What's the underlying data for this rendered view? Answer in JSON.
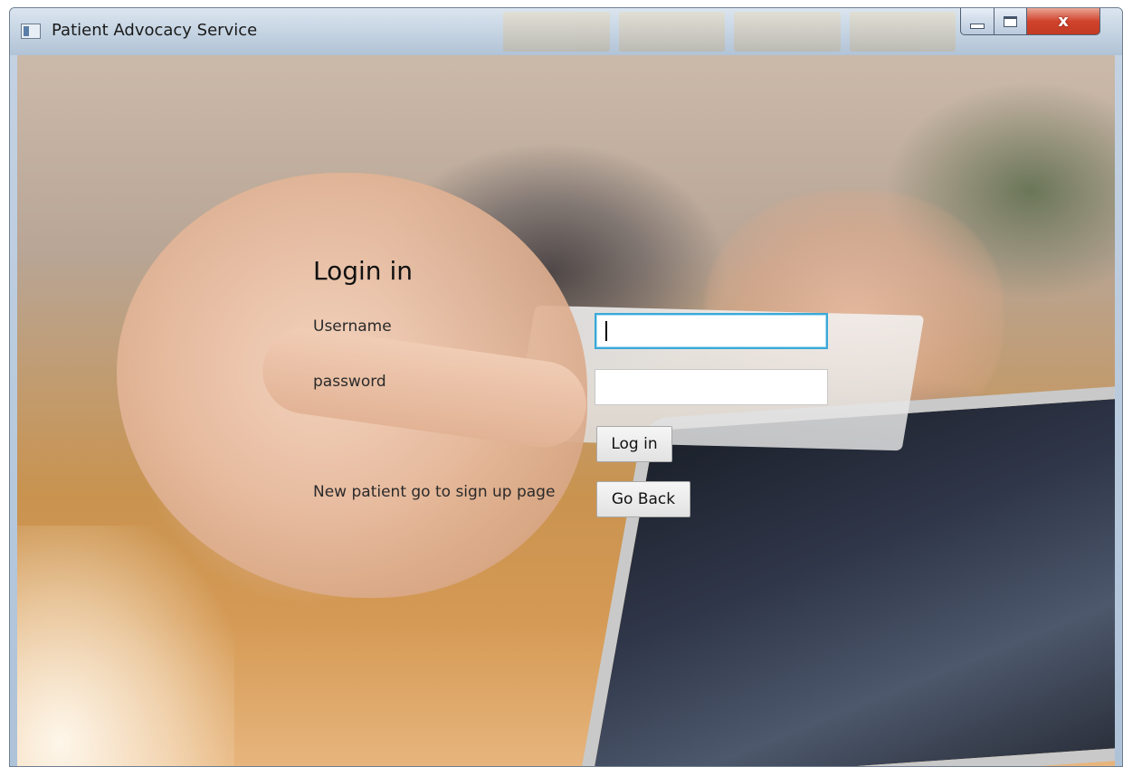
{
  "window": {
    "title": "Patient Advocacy Service",
    "controls": {
      "minimize_icon": "minimize-icon",
      "maximize_icon": "maximize-icon",
      "close_glyph": "x"
    }
  },
  "login": {
    "title": "Login in",
    "username_label": "Username",
    "username_value": "",
    "password_label": "password",
    "password_value": "",
    "login_button": "Log in",
    "new_patient_label": "New patient go to sign up page",
    "go_back_button": "Go Back"
  },
  "colors": {
    "focus_border": "#3aa9d8",
    "close_button": "#d1432d"
  }
}
